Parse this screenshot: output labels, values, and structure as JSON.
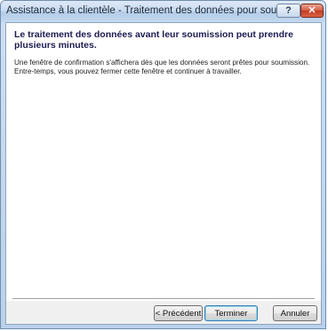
{
  "window": {
    "title": "Assistance à la clientèle - Traitement des données pour soumission",
    "help_label": "?",
    "close_label": "✕"
  },
  "content": {
    "heading": "Le traitement des données avant leur soumission peut prendre plusieurs minutes.",
    "body": "Une fenêtre de confirmation s'affichera dès que les données seront prêtes pour soumission. Entre-temps, vous pouvez fermer cette fenêtre et continuer à travailler."
  },
  "buttons": {
    "previous": "< Précédent",
    "finish": "Terminer",
    "cancel": "Annuler"
  }
}
